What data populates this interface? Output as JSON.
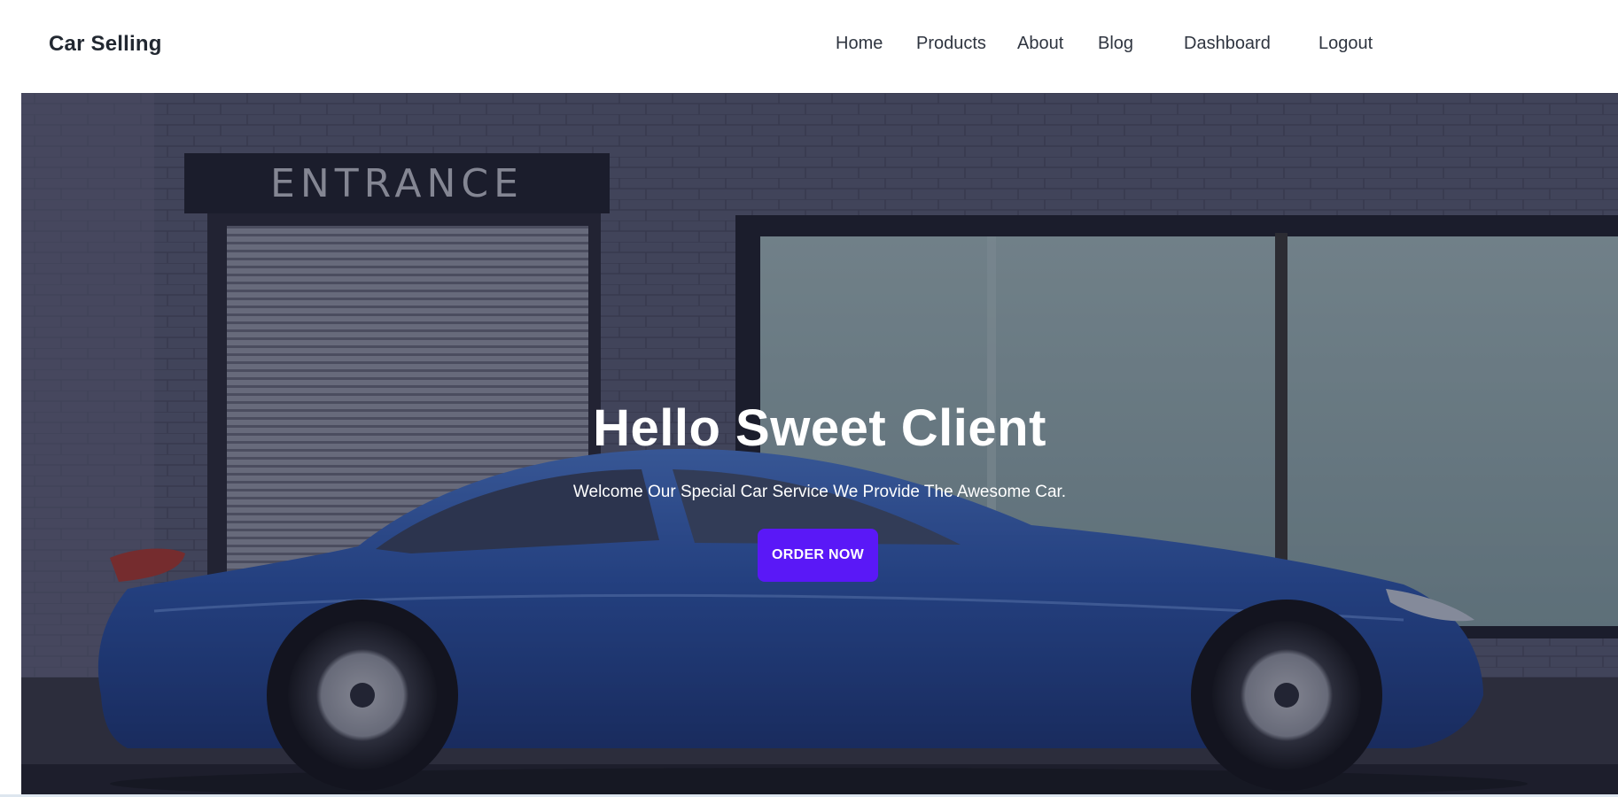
{
  "navbar": {
    "brand": "Car Selling",
    "links": [
      {
        "label": "Home"
      },
      {
        "label": "Products"
      },
      {
        "label": "About"
      },
      {
        "label": "Blog"
      },
      {
        "label": "Dashboard"
      },
      {
        "label": "Logout"
      }
    ]
  },
  "hero": {
    "sign_text": "ENTRANCE",
    "title": "Hello Sweet Client",
    "subtitle": "Welcome Our Special Car Service We Provide The Awesome Car.",
    "cta_label": "ORDER NOW"
  },
  "colors": {
    "accent": "#5a18f7",
    "car_body": "#2c5bb8",
    "wall": "#5c6079"
  }
}
